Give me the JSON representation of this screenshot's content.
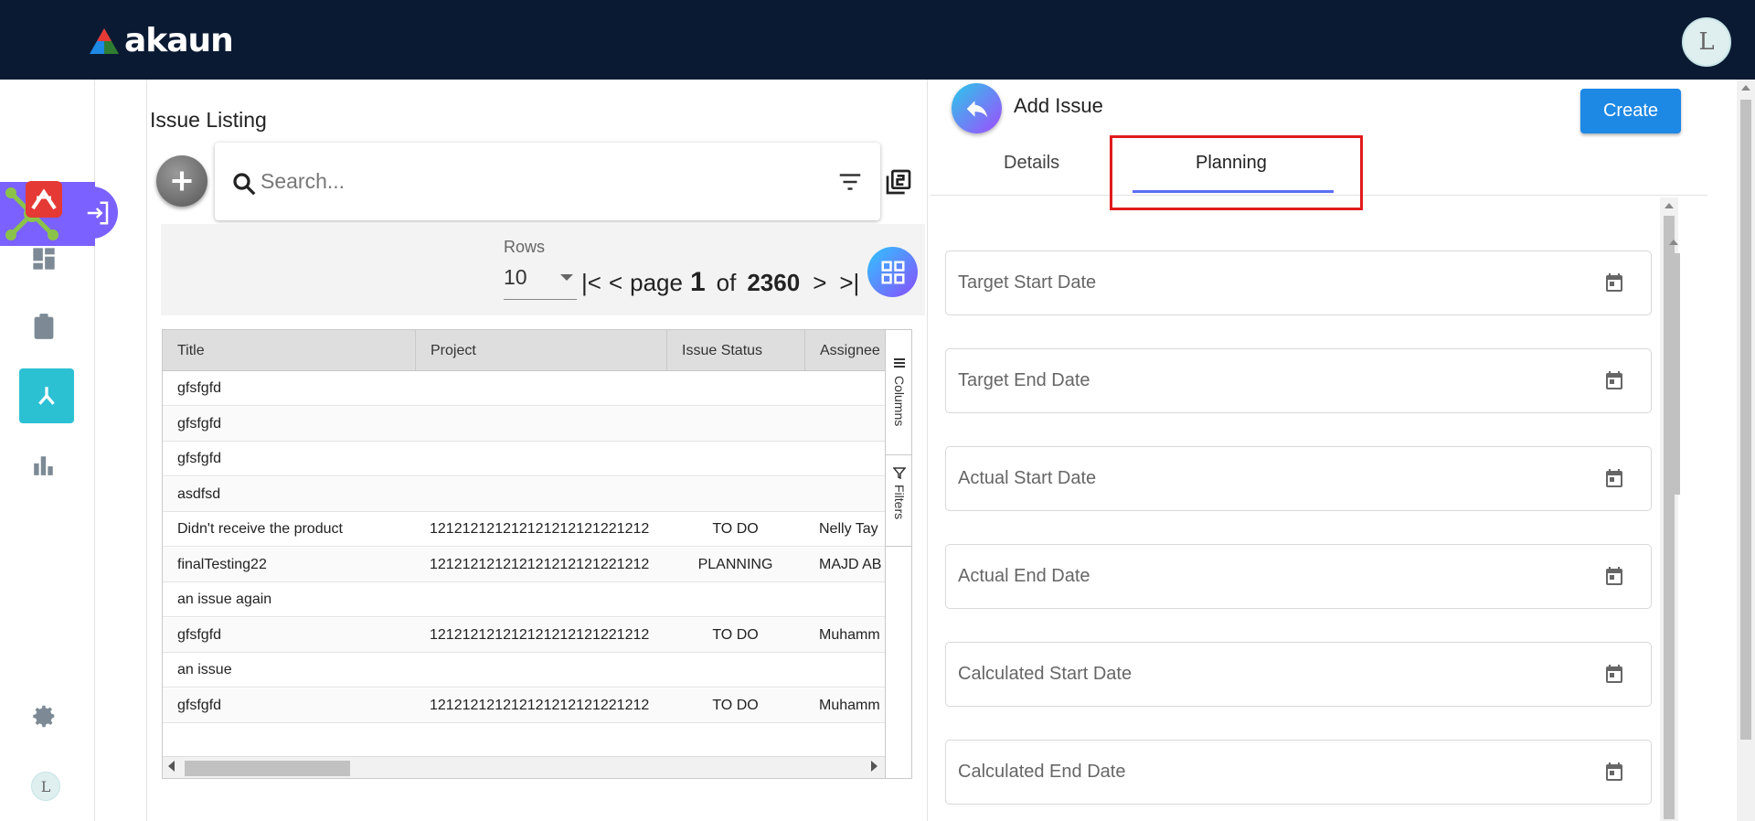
{
  "app": {
    "brand": "akaun",
    "avatar_letter": "L"
  },
  "sidebar": {
    "items": [
      {
        "name": "apps-hub-icon"
      },
      {
        "name": "akaun-module-icon"
      },
      {
        "name": "dashboard-icon"
      },
      {
        "name": "clipboard-icon"
      },
      {
        "name": "issue-tracker-icon"
      },
      {
        "name": "bar-chart-icon"
      },
      {
        "name": "settings-icon"
      },
      {
        "name": "user-avatar"
      }
    ]
  },
  "listing": {
    "title": "Issue Listing",
    "search_placeholder": "Search...",
    "rows_label": "Rows",
    "rows_value": "10",
    "page_label": "page",
    "page_number": "1",
    "of_label": "of",
    "page_total": "2360",
    "columns": [
      "Title",
      "Project",
      "Issue Status",
      "Assignee"
    ],
    "rows": [
      {
        "title": "gfsfgfd",
        "project": "",
        "status": "",
        "assignee": ""
      },
      {
        "title": "gfsfgfd",
        "project": "",
        "status": "",
        "assignee": ""
      },
      {
        "title": "gfsfgfd",
        "project": "",
        "status": "",
        "assignee": ""
      },
      {
        "title": "asdfsd",
        "project": "",
        "status": "",
        "assignee": ""
      },
      {
        "title": "Didn't receive the product",
        "project": "121212121212121212121221212",
        "status": "TO DO",
        "assignee": "Nelly Tay"
      },
      {
        "title": "finalTesting22",
        "project": "121212121212121212121221212",
        "status": "PLANNING",
        "assignee": "MAJD AB"
      },
      {
        "title": "an issue again",
        "project": "",
        "status": "",
        "assignee": ""
      },
      {
        "title": "gfsfgfd",
        "project": "121212121212121212121221212",
        "status": "TO DO",
        "assignee": "Muhamm"
      },
      {
        "title": "an issue",
        "project": "",
        "status": "",
        "assignee": ""
      },
      {
        "title": "gfsfgfd",
        "project": "121212121212121212121221212",
        "status": "TO DO",
        "assignee": "Muhamm"
      }
    ],
    "tool_tabs": [
      "Columns",
      "Filters"
    ]
  },
  "add_issue": {
    "title": "Add Issue",
    "create_label": "Create",
    "tabs": [
      "Details",
      "Planning"
    ],
    "active_tab": "Planning",
    "fields": [
      "Target Start Date",
      "Target End Date",
      "Actual Start Date",
      "Actual End Date",
      "Calculated Start Date",
      "Calculated End Date"
    ]
  },
  "colors": {
    "topbar": "#0b1a33",
    "accent_purple": "#7b61ff",
    "accent_teal": "#2cc0d3",
    "primary_blue": "#1e88e5",
    "highlight_red": "#e01c1c"
  }
}
